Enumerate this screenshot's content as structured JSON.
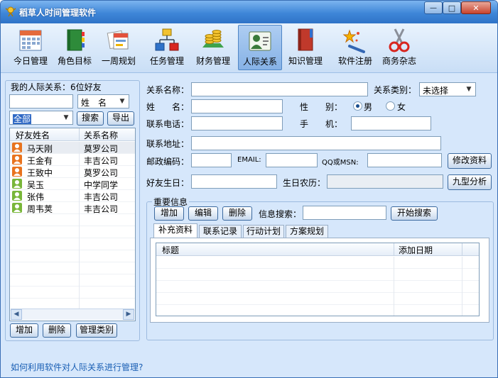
{
  "window": {
    "title": "稻草人时间管理软件",
    "controls": {
      "minimize": "—",
      "maximize": "□",
      "close": "✕"
    }
  },
  "toolbar": {
    "items": [
      {
        "label": "今日管理",
        "icon": "calendar-icon"
      },
      {
        "label": "角色目标",
        "icon": "book-icon"
      },
      {
        "label": "一周规划",
        "icon": "cards-icon"
      },
      {
        "label": "任务管理",
        "icon": "flowchart-icon"
      },
      {
        "label": "财务管理",
        "icon": "coins-icon"
      },
      {
        "label": "人际关系",
        "icon": "contact-card-icon"
      },
      {
        "label": "知识管理",
        "icon": "knowledge-book-icon"
      },
      {
        "label": "软件注册",
        "icon": "magic-wand-icon"
      },
      {
        "label": "商务杂志",
        "icon": "scissors-icon"
      }
    ],
    "active": "人际关系"
  },
  "left": {
    "group_title": "我的人际关系：6位好友",
    "search_value": "",
    "search_field": "姓　名",
    "category": "全部",
    "search_button": "搜索",
    "export_button": "导出",
    "columns": [
      "好友姓名",
      "关系名称"
    ],
    "rows": [
      {
        "name": "马天刚",
        "relation": "莫罗公司",
        "gender": "male"
      },
      {
        "name": "王金有",
        "relation": "丰吉公司",
        "gender": "male"
      },
      {
        "name": "王致中",
        "relation": "莫罗公司",
        "gender": "male"
      },
      {
        "name": "吴玉",
        "relation": "中学同学",
        "gender": "female"
      },
      {
        "name": "张伟",
        "relation": "丰吉公司",
        "gender": "female"
      },
      {
        "name": "周韦荚",
        "relation": "丰吉公司",
        "gender": "female"
      }
    ],
    "add_button": "增加",
    "delete_button": "删除",
    "manage_button": "管理类别"
  },
  "form": {
    "relation_name_label": "关系名称：",
    "relation_name_value": "",
    "relation_type_label": "关系类别：",
    "relation_type_value": "未选择",
    "name_label": "姓　　名：",
    "name_value": "",
    "gender_label": "性　　别：",
    "gender_male": "男",
    "gender_female": "女",
    "phone_label": "联系电话：",
    "phone_value": "",
    "mobile_label": "手　　机：",
    "mobile_value": "",
    "address_label": "联系地址：",
    "address_value": "",
    "zip_label": "邮政编码：",
    "zip_value": "",
    "email_label": "EMAIL:",
    "email_value": "",
    "qq_label": "QQ或MSN:",
    "qq_value": "",
    "modify_button": "修改资料",
    "birthday_label": "好友生日：",
    "birthday_value": "",
    "lunar_label": "生日农历：",
    "lunar_value": "",
    "nine_button": "九型分析"
  },
  "important": {
    "group_title": "重要信息",
    "add_button": "增加",
    "edit_button": "编辑",
    "delete_button": "删除",
    "search_label": "信息搜索：",
    "search_value": "",
    "start_search_button": "开始搜索",
    "tabs": [
      "补充资料",
      "联系记录",
      "行动计划",
      "方案规划"
    ],
    "active_tab": "补充资料",
    "columns": [
      "标题",
      "添加日期"
    ]
  },
  "help_link": "如何利用软件对人际关系进行管理?"
}
